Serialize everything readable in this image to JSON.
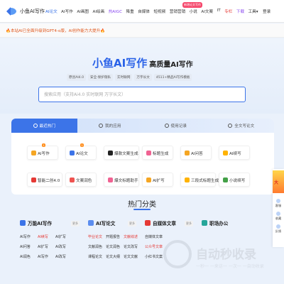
{
  "nav": {
    "logo_text": "小鱼AI写作",
    "items": [
      {
        "label": "AI论文",
        "state": "active"
      },
      {
        "label": "AI写作",
        "state": ""
      },
      {
        "label": "AI画图",
        "state": ""
      },
      {
        "label": "AI绘画",
        "state": ""
      },
      {
        "label": "热AIGC",
        "state": "purple"
      },
      {
        "label": "降重",
        "state": ""
      },
      {
        "label": "自媒体",
        "state": ""
      },
      {
        "label": "短视频",
        "state": ""
      },
      {
        "label": "营销营销",
        "state": ""
      },
      {
        "label": "小说",
        "state": ""
      },
      {
        "label": "AI文案",
        "state": ""
      },
      {
        "label": "IT",
        "state": ""
      },
      {
        "label": "专栏",
        "state": "red"
      },
      {
        "label": "下载",
        "state": "purple"
      },
      {
        "label": "工具▾",
        "state": ""
      }
    ],
    "hot_badge": "新增论文写作",
    "login": "登录"
  },
  "announce": {
    "text": "🔥本站AI已全面升级到GPT4-o版，AI创作能力大提升🔥"
  },
  "hero": {
    "title_big": "小鱼AI写作",
    "title_small": "高质量AI写作",
    "chips": [
      "原创AI4.0",
      "安全·保护隐私",
      "实时联网",
      "万字长文",
      "4511+精品AI写作模板"
    ],
    "search_placeholder": "搜索应用（支持Ai4.0 实时联网 万字长文）"
  },
  "tabs": [
    {
      "label": "最近热门",
      "active": true
    },
    {
      "label": "我的应用",
      "active": false
    },
    {
      "label": "使用记录",
      "active": false
    },
    {
      "label": "全文写论文",
      "active": false
    }
  ],
  "tools": [
    {
      "label": "AI写作",
      "badge": "1",
      "color": "#f5a623"
    },
    {
      "label": "AI论文",
      "badge": "1",
      "color": "#3c74e8"
    },
    {
      "label": "爆款文案生成",
      "badge": "",
      "color": "#222222"
    },
    {
      "label": "标题生成",
      "badge": "",
      "color": "#f06292"
    },
    {
      "label": "AI问答",
      "badge": "",
      "color": "#f5a623"
    },
    {
      "label": "AI续写",
      "badge": "",
      "color": "#ffb300"
    },
    {
      "label": "智能二创4.0",
      "badge": "",
      "color": "#e53935"
    },
    {
      "label": "文案润色",
      "badge": "",
      "color": "#ef5350"
    },
    {
      "label": "爆文标题助手",
      "badge": "",
      "color": "#f06292"
    },
    {
      "label": "AI扩写",
      "badge": "",
      "color": "#f5a623"
    },
    {
      "label": "三段式标题生成",
      "badge": "",
      "color": "#ffb300"
    },
    {
      "label": "小说续写",
      "badge": "",
      "color": "#43a047"
    }
  ],
  "sidebar_right": {
    "promo": "大",
    "buttons": [
      "客服",
      "收藏",
      "反馈"
    ]
  },
  "hot": {
    "title": "热门分类"
  },
  "categories": [
    {
      "title": "万能AI写作",
      "icon_color": "#3c74e8",
      "more": "更多",
      "links": [
        {
          "text": "AI写作",
          "hi": false
        },
        {
          "text": "AI续写",
          "hi": true
        },
        {
          "text": "AI扩写",
          "hi": false
        },
        {
          "text": "AI问答",
          "hi": false
        },
        {
          "text": "AI扩写",
          "hi": false
        },
        {
          "text": "AI改写",
          "hi": false
        },
        {
          "text": "AI润色",
          "hi": false
        },
        {
          "text": "AI写作",
          "hi": false
        },
        {
          "text": "AI改写",
          "hi": false
        }
      ]
    },
    {
      "title": "AI写论文",
      "icon_color": "#5b8def",
      "more": "更多",
      "links": [
        {
          "text": "毕业论文",
          "hi": true
        },
        {
          "text": "开题报告",
          "hi": false
        },
        {
          "text": "文献综述",
          "hi": true
        },
        {
          "text": "文献润色",
          "hi": false
        },
        {
          "text": "论文润色",
          "hi": false
        },
        {
          "text": "论文改写",
          "hi": false
        },
        {
          "text": "课程论文",
          "hi": false
        },
        {
          "text": "论文大纲",
          "hi": false
        },
        {
          "text": "论文文献",
          "hi": false
        }
      ]
    },
    {
      "title": "自媒体文章",
      "icon_color": "#e53935",
      "more": "更多",
      "links": [
        {
          "text": "自媒体文章",
          "hi": false
        },
        {
          "text": "",
          "hi": false
        },
        {
          "text": "",
          "hi": false
        },
        {
          "text": "公众号文章",
          "hi": true
        },
        {
          "text": "",
          "hi": false
        },
        {
          "text": "",
          "hi": false
        },
        {
          "text": "小红书文案",
          "hi": false
        },
        {
          "text": "",
          "hi": false
        },
        {
          "text": "",
          "hi": false
        }
      ]
    },
    {
      "title": "职场办公",
      "icon_color": "#26a69a",
      "more": "",
      "links": []
    }
  ],
  "watermark": {
    "text": "自动秒收录",
    "sub": "一秒一 一来访一 一次一 一自动收录"
  }
}
